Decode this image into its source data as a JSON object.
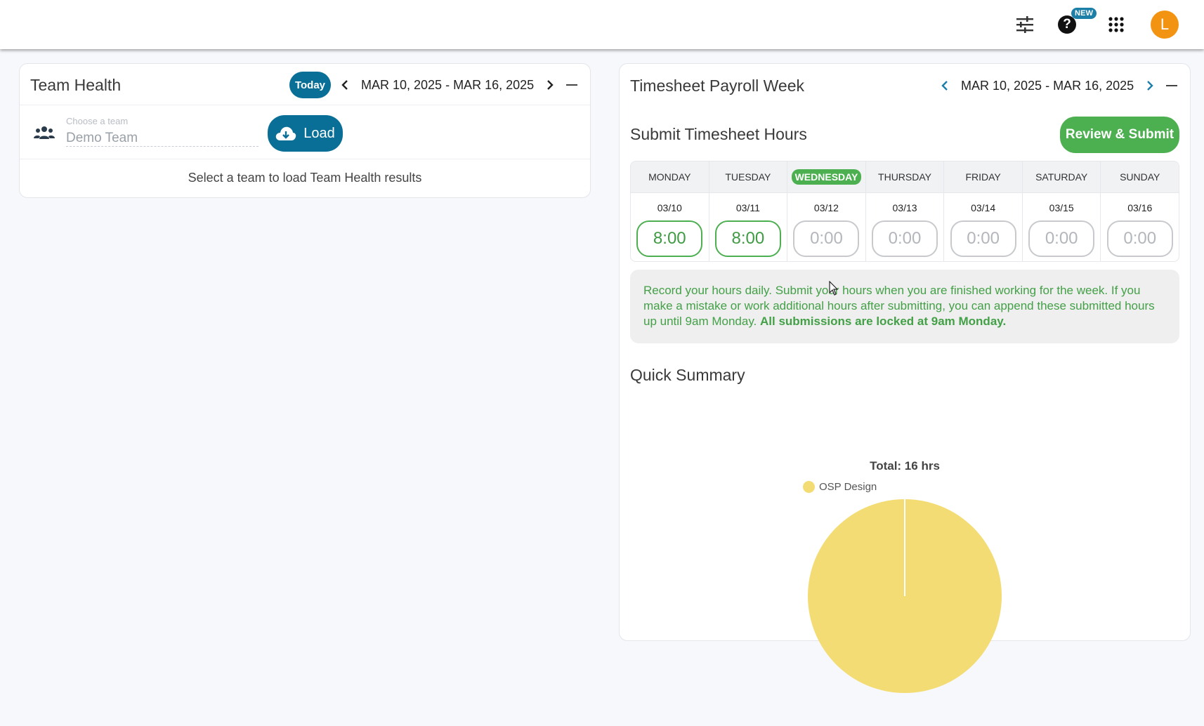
{
  "topbar": {
    "icons": [
      "tune-icon",
      "help-icon",
      "apps-icon"
    ],
    "new_badge": "NEW",
    "avatar_letter": "L"
  },
  "team_health": {
    "title": "Team Health",
    "today_label": "Today",
    "date_range": "MAR 10, 2025 - MAR 16, 2025",
    "team_field": {
      "label": "Choose a team",
      "value": "Demo Team"
    },
    "load_label": "Load",
    "empty_message": "Select a team to load Team Health results"
  },
  "timesheet": {
    "title": "Timesheet Payroll Week",
    "date_range": "MAR 10, 2025 - MAR 16, 2025",
    "submit_title": "Submit Timesheet Hours",
    "review_label": "Review & Submit",
    "days": [
      {
        "name": "MONDAY",
        "date": "03/10",
        "hours": "8:00",
        "filled": true,
        "today": false
      },
      {
        "name": "TUESDAY",
        "date": "03/11",
        "hours": "8:00",
        "filled": true,
        "today": false
      },
      {
        "name": "WEDNESDAY",
        "date": "03/12",
        "hours": "0:00",
        "filled": false,
        "today": true
      },
      {
        "name": "THURSDAY",
        "date": "03/13",
        "hours": "0:00",
        "filled": false,
        "today": false
      },
      {
        "name": "FRIDAY",
        "date": "03/14",
        "hours": "0:00",
        "filled": false,
        "today": false
      },
      {
        "name": "SATURDAY",
        "date": "03/15",
        "hours": "0:00",
        "filled": false,
        "today": false
      },
      {
        "name": "SUNDAY",
        "date": "03/16",
        "hours": "0:00",
        "filled": false,
        "today": false
      }
    ],
    "info_text": "Record your hours daily. Submit your hours when you are finished working for the week. If you make a mistake or work additional hours after submitting, you can append these submitted hours up until 9am Monday. ",
    "info_bold": "All submissions are locked at 9am Monday.",
    "quick_summary_title": "Quick Summary"
  },
  "chart_data": {
    "type": "pie",
    "title": "Total: 16 hrs",
    "categories": [
      "OSP Design"
    ],
    "values": [
      16
    ],
    "colors": [
      "#f4dc74"
    ],
    "legend_position": "top"
  },
  "colors": {
    "primary": "#0a6f97",
    "success": "#4caf50",
    "avatar": "#f39312"
  }
}
